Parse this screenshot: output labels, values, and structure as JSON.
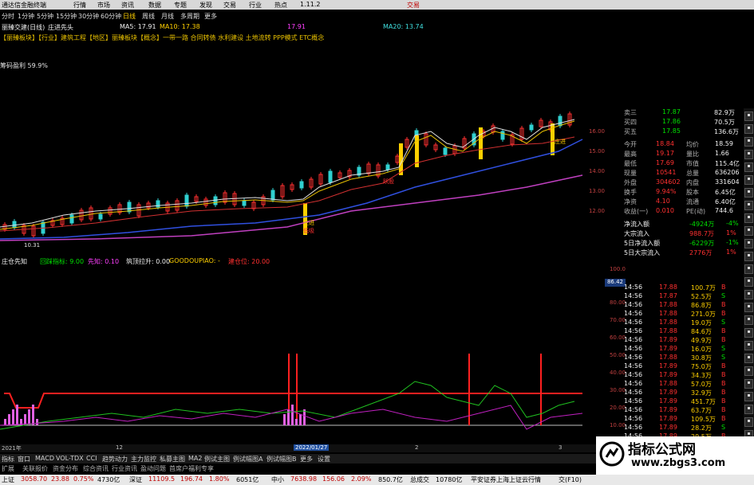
{
  "titlebar": {
    "app_name": "通达信金融终端",
    "menu": [
      "行情",
      "市场",
      "资讯",
      "数据",
      "专题",
      "发现",
      "交易",
      "行业",
      "热点"
    ],
    "version": "1.11.2",
    "trade_label": "交易"
  },
  "toolbar": {
    "periods": [
      "分时",
      "1分钟",
      "5分钟",
      "15分钟",
      "30分钟",
      "60分钟",
      "日线",
      "周线",
      "月线",
      "多周期",
      "更多"
    ],
    "active": "日线"
  },
  "stock": {
    "name": "丽臻交建(日线)",
    "indicator": "庄进先头"
  },
  "ma": {
    "ma5": "MA5: 17.91",
    "ma10": "MA10: 17.38",
    "ma20": "17.91",
    "ma60": "MA20: 13.74"
  },
  "concepts": "【丽臻板块】【行业】建筑工程【地区】丽臻板块【概念】一带一路 合同转债 水利建设 土地流转 PPP模式 ETC概念",
  "chip_text": "筹码盈利 59.9%",
  "chart_labels": {
    "low_price": "10.31",
    "buy1": "庄进",
    "buy2": "跃股",
    "buy3": "低吸",
    "buy4": "庄进"
  },
  "price_axis": [
    "16.00",
    "15.00",
    "14.00",
    "13.00",
    "12.00"
  ],
  "indicator_head": {
    "name": "庄仓先知",
    "line1": "回踩指标: 9.00",
    "line2": "先知: 0.10",
    "line3": "筑顶拉升: 0.00",
    "line4": "GOODOUPIAO: -",
    "line5": "建仓位: 20.00"
  },
  "ind_axis": [
    "100.0",
    "90.00",
    "80.00",
    "70.00",
    "60.00",
    "50.00",
    "40.00",
    "30.00",
    "20.00",
    "10.00"
  ],
  "axis_badge": "86.42",
  "date_bar": {
    "d1": "2021年",
    "d2": "12",
    "d3": "2022/01/27",
    "d4": "2",
    "d5": "3"
  },
  "tabs": [
    "指标",
    "窗口",
    "MACD",
    "VOL-TDX",
    "CCI",
    "趋势动力",
    "主力监控",
    "私募主图",
    "MA2",
    "例试主图",
    "例试幅图A",
    "例试幅图B",
    "更多",
    "设置"
  ],
  "subtabs": [
    "扩展",
    "关联报价",
    "资金分布",
    "综合资讯",
    "行业资讯",
    "盈动问题",
    "首席户福利专享"
  ],
  "quote": {
    "rows": [
      {
        "label": "卖三",
        "price": "17.87",
        "vol": "82.9万"
      },
      {
        "label": "买四",
        "price": "17.86",
        "vol": "70.5万"
      },
      {
        "label": "买五",
        "price": "17.85",
        "vol": "136.6万"
      }
    ],
    "stats": [
      {
        "l1": "今开",
        "v1": "18.84",
        "l2": "均价",
        "v2": "18.59"
      },
      {
        "l1": "最高",
        "v1": "19.17",
        "l2": "量比",
        "v2": "1.66"
      },
      {
        "l1": "最低",
        "v1": "17.69",
        "l2": "市值",
        "v2": "115.4亿"
      },
      {
        "l1": "现量",
        "v1": "10541",
        "l2": "总量",
        "v2": "636206"
      },
      {
        "l1": "外盘",
        "v1": "304602",
        "l2": "内盘",
        "v2": "331604"
      },
      {
        "l1": "换手",
        "v1": "9.94%",
        "l2": "股本",
        "v2": "6.45亿"
      },
      {
        "l1": "净资",
        "v1": "4.10",
        "l2": "流通",
        "v2": "6.40亿"
      },
      {
        "l1": "收益(一)",
        "v1": "0.010",
        "l2": "PE(动)",
        "v2": "744.6"
      }
    ],
    "flows": [
      {
        "label": "净流入额",
        "value": "-4924万",
        "pct": "-4%"
      },
      {
        "label": "大宗流入",
        "value": "988.7万",
        "pct": "1%"
      },
      {
        "label": "5日净流入额",
        "value": "-6229万",
        "pct": "-1%"
      },
      {
        "label": "5日大宗流入",
        "value": "2776万",
        "pct": "1%"
      }
    ]
  },
  "trades": [
    {
      "t": "14:56",
      "p": "17.88",
      "v": "100.7万",
      "s": "B"
    },
    {
      "t": "14:56",
      "p": "17.87",
      "v": "52.5万",
      "s": "S"
    },
    {
      "t": "14:56",
      "p": "17.88",
      "v": "86.8万",
      "s": "B"
    },
    {
      "t": "14:56",
      "p": "17.88",
      "v": "271.0万",
      "s": "B"
    },
    {
      "t": "14:56",
      "p": "17.88",
      "v": "19.0万",
      "s": "S"
    },
    {
      "t": "14:56",
      "p": "17.88",
      "v": "84.6万",
      "s": "B"
    },
    {
      "t": "14:56",
      "p": "17.89",
      "v": "49.9万",
      "s": "B"
    },
    {
      "t": "14:56",
      "p": "17.89",
      "v": "16.0万",
      "s": "S"
    },
    {
      "t": "14:56",
      "p": "17.88",
      "v": "30.8万",
      "s": "S"
    },
    {
      "t": "14:56",
      "p": "17.89",
      "v": "75.0万",
      "s": "B"
    },
    {
      "t": "14:56",
      "p": "17.89",
      "v": "34.3万",
      "s": "B"
    },
    {
      "t": "14:56",
      "p": "17.88",
      "v": "57.0万",
      "s": "B"
    },
    {
      "t": "14:56",
      "p": "17.89",
      "v": "32.9万",
      "s": "B"
    },
    {
      "t": "14:56",
      "p": "17.89",
      "v": "451.7万",
      "s": "B"
    },
    {
      "t": "14:56",
      "p": "17.89",
      "v": "63.7万",
      "s": "B"
    },
    {
      "t": "14:56",
      "p": "17.89",
      "v": "109.5万",
      "s": "B"
    },
    {
      "t": "14:56",
      "p": "17.89",
      "v": "28.2万",
      "s": "S"
    },
    {
      "t": "14:56",
      "p": "17.89",
      "v": "29.5万",
      "s": "B"
    }
  ],
  "statusbar": {
    "sh_label": "上证",
    "sh_value": "3058.70",
    "sh_chg": "23.88",
    "sh_pct": "0.75%",
    "sh_amt": "4730亿",
    "sz_label": "深证",
    "sz_value": "11109.5",
    "sz_chg": "196.74",
    "sz_pct": "1.80%",
    "sz_amt": "6051亿",
    "zx_label": "中小",
    "zx_value": "7638.98",
    "zx_chg": "156.06",
    "zx_pct": "2.09%",
    "zx_amt": "850.7亿",
    "total_label": "总成交",
    "total_value": "10780亿",
    "broker": "平安证券上海上证云行情",
    "extra": "交(F10)"
  },
  "watermark": {
    "title": "指标公式网",
    "url": "www.zbgs3.com"
  }
}
